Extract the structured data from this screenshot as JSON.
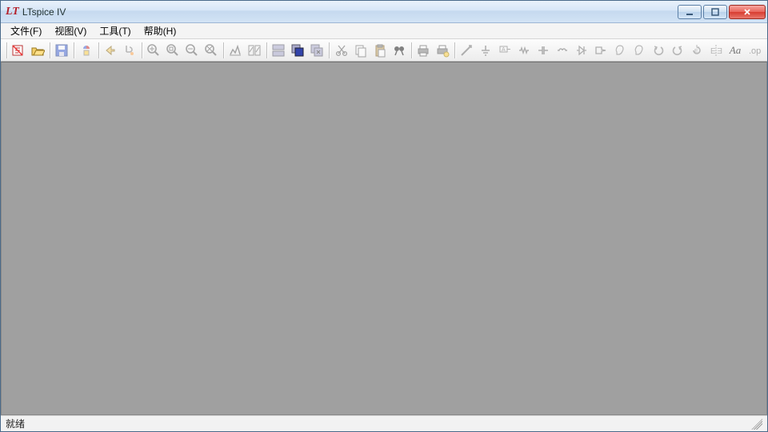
{
  "titlebar": {
    "app_name": "LTspice IV"
  },
  "menu": {
    "file": "文件(F)",
    "view": "视图(V)",
    "tools": "工具(T)",
    "help": "帮助(H)"
  },
  "toolbar": {
    "items": [
      "new-schematic",
      "open",
      "sep",
      "save",
      "sep",
      "control-panel",
      "sep",
      "run",
      "halt",
      "sep",
      "zoom-in",
      "pan",
      "zoom-out",
      "zoom-fit",
      "sep",
      "autorange",
      "toggle-plot",
      "sep",
      "tile",
      "cascade",
      "close-all",
      "sep",
      "cut",
      "copy",
      "paste",
      "find",
      "sep",
      "print",
      "setup",
      "sep",
      "draw-wire",
      "ground",
      "label-net",
      "resistor",
      "capacitor",
      "inductor",
      "diode",
      "component",
      "move",
      "drag",
      "undo",
      "redo",
      "rotate",
      "mirror",
      "text",
      "spice-directive"
    ],
    "labels": {
      "new-schematic": "New",
      "open": "Open",
      "save": "Save",
      "control-panel": "Control Panel",
      "run": "Run",
      "halt": "Halt",
      "zoom-in": "Zoom In",
      "pan": "Pan",
      "zoom-out": "Zoom Out",
      "zoom-fit": "Zoom Full",
      "autorange": "Autorange",
      "toggle-plot": "Pick Visible Traces",
      "tile": "Tile",
      "cascade": "Cascade",
      "close-all": "Close All",
      "cut": "Cut",
      "copy": "Copy",
      "paste": "Paste",
      "find": "Find",
      "print": "Print",
      "setup": "Print Setup",
      "draw-wire": "Wire",
      "ground": "Ground",
      "label-net": "Net Label",
      "resistor": "Resistor",
      "capacitor": "Capacitor",
      "inductor": "Inductor",
      "diode": "Diode",
      "component": "Component",
      "move": "Move",
      "drag": "Drag",
      "undo": "Undo",
      "redo": "Redo",
      "rotate": "Rotate",
      "mirror": "Mirror",
      "text": "Text",
      "spice-directive": "SPICE Directive"
    }
  },
  "statusbar": {
    "status": "就绪"
  },
  "colors": {
    "accent_red": "#b4202a",
    "workspace_bg": "#a0a0a0"
  }
}
